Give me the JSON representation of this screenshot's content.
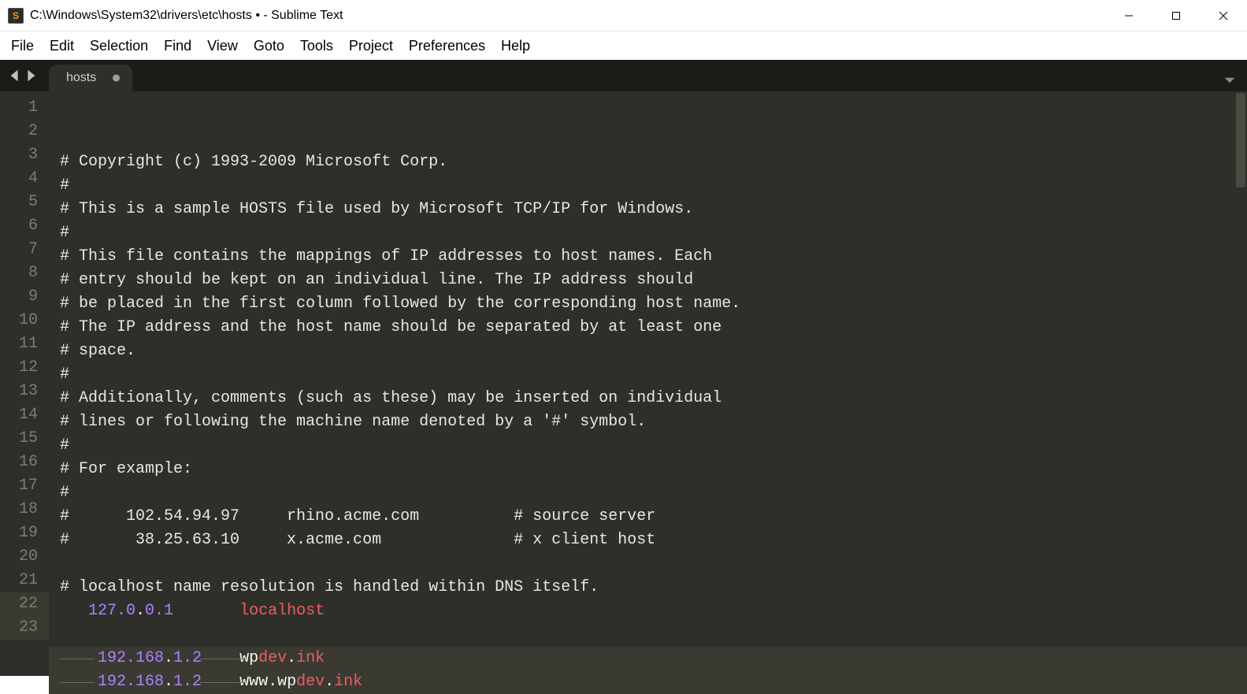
{
  "window": {
    "title": "C:\\Windows\\System32\\drivers\\etc\\hosts • - Sublime Text",
    "app_icon_letter": "S"
  },
  "menu": {
    "items": [
      "File",
      "Edit",
      "Selection",
      "Find",
      "View",
      "Goto",
      "Tools",
      "Project",
      "Preferences",
      "Help"
    ]
  },
  "tabs": {
    "active": {
      "label": "hosts",
      "dirty": true
    }
  },
  "editor": {
    "highlighted_lines": [
      22,
      23
    ],
    "lines": [
      {
        "n": 1,
        "segs": [
          {
            "cls": "tok-comment",
            "t": "# Copyright (c) 1993-2009 Microsoft Corp."
          }
        ]
      },
      {
        "n": 2,
        "segs": [
          {
            "cls": "tok-comment",
            "t": "#"
          }
        ]
      },
      {
        "n": 3,
        "segs": [
          {
            "cls": "tok-comment",
            "t": "# This is a sample HOSTS file used by Microsoft TCP/IP for Windows."
          }
        ]
      },
      {
        "n": 4,
        "segs": [
          {
            "cls": "tok-comment",
            "t": "#"
          }
        ]
      },
      {
        "n": 5,
        "segs": [
          {
            "cls": "tok-comment",
            "t": "# This file contains the mappings of IP addresses to host names. Each"
          }
        ]
      },
      {
        "n": 6,
        "segs": [
          {
            "cls": "tok-comment",
            "t": "# entry should be kept on an individual line. The IP address should"
          }
        ]
      },
      {
        "n": 7,
        "segs": [
          {
            "cls": "tok-comment",
            "t": "# be placed in the first column followed by the corresponding host name."
          }
        ]
      },
      {
        "n": 8,
        "segs": [
          {
            "cls": "tok-comment",
            "t": "# The IP address and the host name should be separated by at least one"
          }
        ]
      },
      {
        "n": 9,
        "segs": [
          {
            "cls": "tok-comment",
            "t": "# space."
          }
        ]
      },
      {
        "n": 10,
        "segs": [
          {
            "cls": "tok-comment",
            "t": "#"
          }
        ]
      },
      {
        "n": 11,
        "segs": [
          {
            "cls": "tok-comment",
            "t": "# Additionally, comments (such as these) may be inserted on individual"
          }
        ]
      },
      {
        "n": 12,
        "segs": [
          {
            "cls": "tok-comment",
            "t": "# lines or following the machine name denoted by a '#' symbol."
          }
        ]
      },
      {
        "n": 13,
        "segs": [
          {
            "cls": "tok-comment",
            "t": "#"
          }
        ]
      },
      {
        "n": 14,
        "segs": [
          {
            "cls": "tok-comment",
            "t": "# For example:"
          }
        ]
      },
      {
        "n": 15,
        "segs": [
          {
            "cls": "tok-comment",
            "t": "#"
          }
        ]
      },
      {
        "n": 16,
        "segs": [
          {
            "cls": "tok-comment",
            "t": "#      102.54.94.97     rhino.acme.com          # source server"
          }
        ]
      },
      {
        "n": 17,
        "segs": [
          {
            "cls": "tok-comment",
            "t": "#       38.25.63.10     x.acme.com              # x client host"
          }
        ]
      },
      {
        "n": 18,
        "segs": [
          {
            "cls": "tok-plain",
            "t": ""
          }
        ]
      },
      {
        "n": 19,
        "segs": [
          {
            "cls": "tok-comment",
            "t": "# localhost name resolution is handled within DNS itself."
          }
        ]
      },
      {
        "n": 20,
        "segs": [
          {
            "cls": "tok-plain",
            "t": "   "
          },
          {
            "cls": "tok-num",
            "t": "127.0"
          },
          {
            "cls": "tok-dot",
            "t": "."
          },
          {
            "cls": "tok-num",
            "t": "0.1"
          },
          {
            "cls": "tok-plain",
            "t": "       "
          },
          {
            "cls": "tok-err-w",
            "t": "localhost"
          }
        ]
      },
      {
        "n": 21,
        "segs": [
          {
            "cls": "tok-plain",
            "t": ""
          }
        ]
      },
      {
        "n": 22,
        "segs": [
          {
            "cls": "tok-plain",
            "t": "    "
          },
          {
            "cls": "tok-num",
            "t": "192.168"
          },
          {
            "cls": "tok-dot",
            "t": "."
          },
          {
            "cls": "tok-num",
            "t": "1.2"
          },
          {
            "cls": "tok-plain",
            "t": "    wp"
          },
          {
            "cls": "tok-err-w",
            "t": "dev"
          },
          {
            "cls": "tok-dot",
            "t": "."
          },
          {
            "cls": "tok-err-w",
            "t": "ink"
          }
        ]
      },
      {
        "n": 23,
        "segs": [
          {
            "cls": "tok-plain",
            "t": "    "
          },
          {
            "cls": "tok-num",
            "t": "192.168"
          },
          {
            "cls": "tok-dot",
            "t": "."
          },
          {
            "cls": "tok-num",
            "t": "1.2"
          },
          {
            "cls": "tok-plain",
            "t": "    www.wp"
          },
          {
            "cls": "tok-err-w",
            "t": "dev"
          },
          {
            "cls": "tok-dot",
            "t": "."
          },
          {
            "cls": "tok-err-w",
            "t": "ink"
          }
        ]
      }
    ]
  }
}
